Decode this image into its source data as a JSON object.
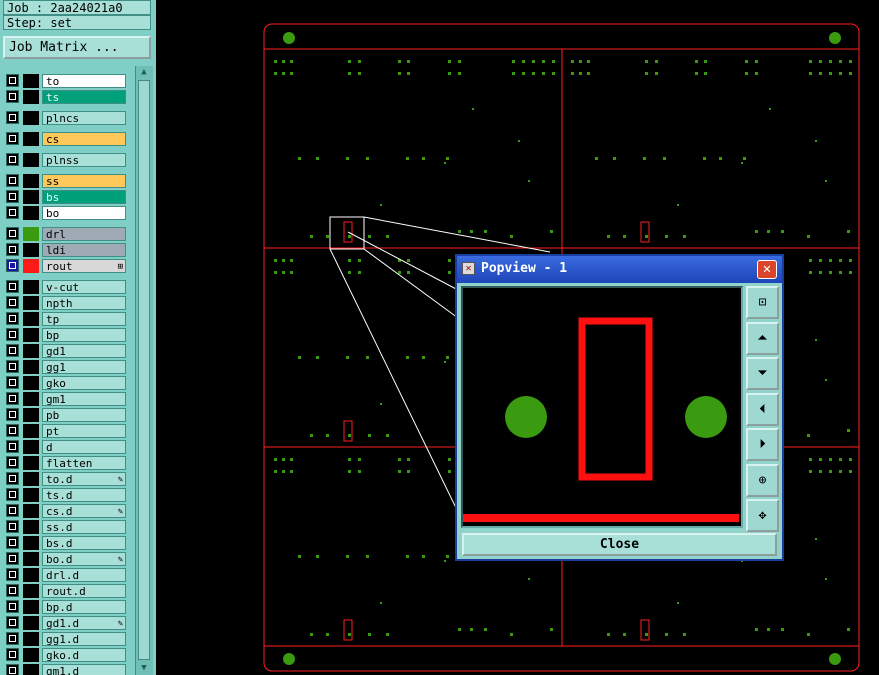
{
  "header": {
    "job_label": "Job : 2aa24021a0",
    "step_label": "Step: set",
    "matrix_button": "Job Matrix ..."
  },
  "layers": [
    {
      "name": "to",
      "color": "#ffffff"
    },
    {
      "name": "ts",
      "color": "#00a07a"
    },
    {
      "name": "plncs",
      "color": "#a8e0d8"
    },
    {
      "name": "cs",
      "color": "#ffc85a"
    },
    {
      "name": "plnss",
      "color": "#a8e0d8"
    },
    {
      "name": "ss",
      "color": "#ffc85a"
    },
    {
      "name": "bs",
      "color": "#00a07a"
    },
    {
      "name": "bo",
      "color": "#ffffff"
    },
    {
      "name": "drl",
      "color": "#a0aab4"
    },
    {
      "name": "ldi",
      "color": "#a0aab4"
    },
    {
      "name": "rout",
      "color": "#d8d8d8"
    },
    {
      "name": "v-cut"
    },
    {
      "name": "npth"
    },
    {
      "name": "tp"
    },
    {
      "name": "bp"
    },
    {
      "name": "gd1"
    },
    {
      "name": "gg1"
    },
    {
      "name": "gko"
    },
    {
      "name": "gm1"
    },
    {
      "name": "pb"
    },
    {
      "name": "pt"
    },
    {
      "name": "d"
    },
    {
      "name": "flatten"
    },
    {
      "name": "to.d"
    },
    {
      "name": "ts.d"
    },
    {
      "name": "cs.d"
    },
    {
      "name": "ss.d"
    },
    {
      "name": "bs.d"
    },
    {
      "name": "bo.d"
    },
    {
      "name": "drl.d"
    },
    {
      "name": "rout.d"
    },
    {
      "name": "bp.d"
    },
    {
      "name": "gd1.d"
    },
    {
      "name": "gg1.d"
    },
    {
      "name": "gko.d"
    },
    {
      "name": "gm1.d"
    }
  ],
  "popup": {
    "title": "Popview - 1",
    "close_button": "Close",
    "tools": [
      "zoom-fit-icon",
      "pan-up-icon",
      "pan-down-icon",
      "pan-left-icon",
      "pan-right-icon",
      "zoom-in-icon",
      "zoom-out-icon"
    ]
  },
  "colors": {
    "panel_bg": "#7fcfc6",
    "board_outline": "#ff2020",
    "pad_green": "#3a9a10",
    "popup_title": "#1d45b8"
  }
}
